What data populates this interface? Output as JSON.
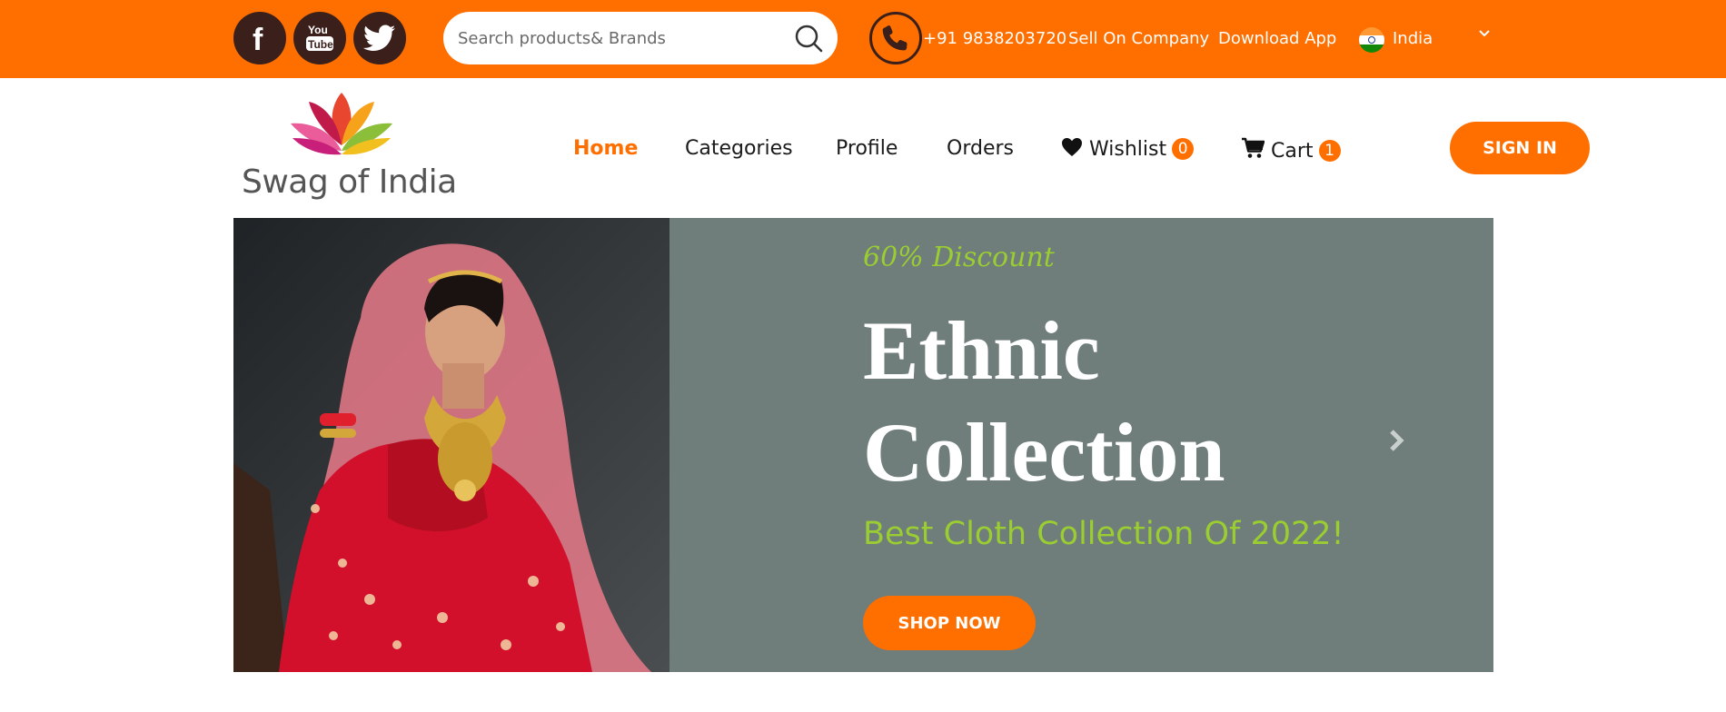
{
  "topbar": {
    "search_placeholder": "Search products& Brands",
    "phone": "+91 9838203720",
    "sell": "Sell On Company",
    "download": "Download App",
    "country": "India",
    "social": [
      "facebook-icon",
      "youtube-icon",
      "twitter-icon"
    ]
  },
  "header": {
    "logo_text": "Swag of India",
    "nav": {
      "home": "Home",
      "categories": "Categories",
      "profile": "Profile",
      "orders": "Orders",
      "wishlist": "Wishlist",
      "wishlist_count": "0",
      "cart": "Cart",
      "cart_count": "1"
    },
    "signin": "SIGN IN"
  },
  "banner": {
    "discount": "60% Discount",
    "title_line1": "Ethnic",
    "title_line2": "Collection",
    "subtitle": "Best Cloth Collection Of 2022!",
    "cta": "SHOP NOW"
  },
  "colors": {
    "accent": "#ff6f00",
    "banner_bg": "#6f7d7b",
    "highlight_green": "#9acd32"
  }
}
